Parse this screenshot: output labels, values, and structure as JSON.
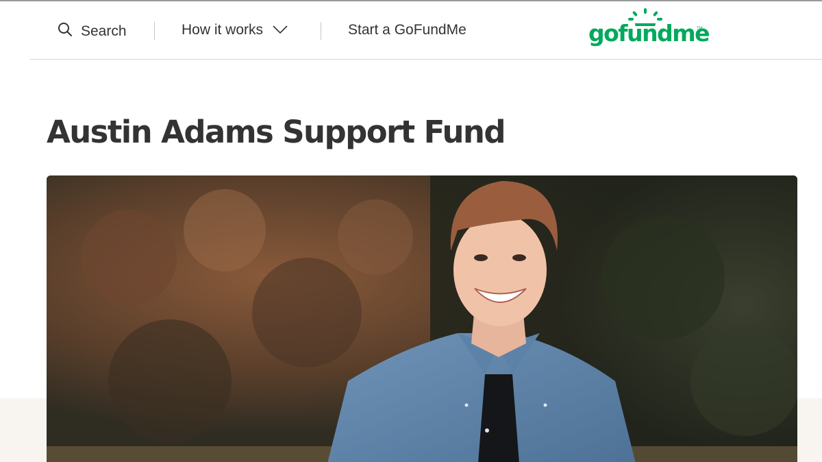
{
  "header": {
    "search_label": "Search",
    "how_it_works_label": "How it works",
    "start_label": "Start a GoFundMe",
    "logo_text": "gofundme",
    "logo_tm": "TM"
  },
  "campaign": {
    "title": "Austin Adams Support Fund"
  },
  "colors": {
    "brand_green": "#02a95c",
    "text": "#333333",
    "band": "#f8f4ef"
  },
  "icons": {
    "search": "search-icon",
    "dropdown": "chevron-down-icon",
    "logo_sun": "sun-icon"
  }
}
